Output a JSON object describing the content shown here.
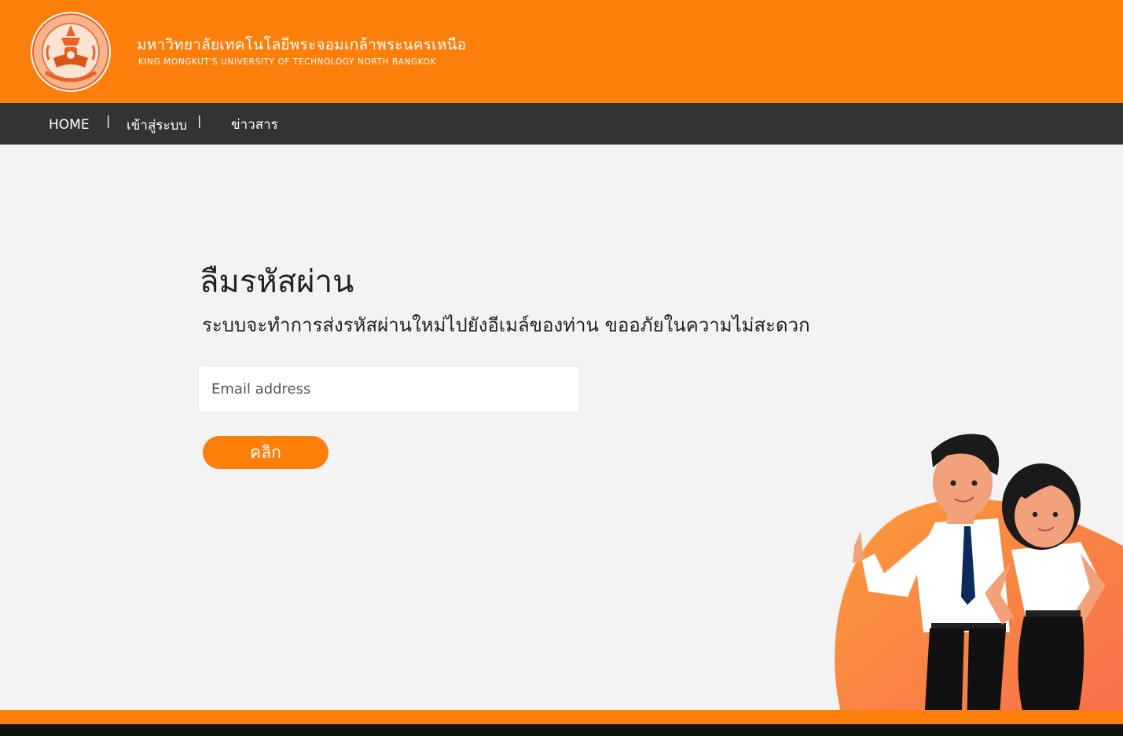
{
  "header": {
    "university_name_th": "มหาวิทยาลัยเทคโนโลยีพระจอมเกล้าพระนครเหนือ",
    "university_name_en": "KING MONGKUT'S UNIVERSITY OF TECHNOLOGY NORTH BANGKOK",
    "logo_icon": "kmutnb-seal-icon"
  },
  "nav": {
    "items": [
      {
        "label": "HOME"
      },
      {
        "label": "เข้าสู่ระบบ"
      },
      {
        "label": "ข่าวสาร"
      }
    ],
    "separator": "|"
  },
  "main": {
    "title": "ลืมรหัสผ่าน",
    "description": "ระบบจะทำการส่งรหัสผ่านใหม่ไปยังอีเมล์ของท่าน ขออภัยในความไม่สะดวก",
    "email_placeholder": "Email address",
    "email_value": "",
    "submit_label": "คลิก"
  },
  "illustration": {
    "icon": "students-illustration-icon"
  },
  "colors": {
    "accent": "#fc7f0b",
    "nav_bg": "#333333",
    "page_bg": "#f3f3f3",
    "footer_dark": "#111111"
  }
}
